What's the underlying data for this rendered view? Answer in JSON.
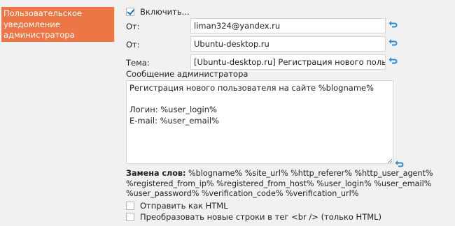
{
  "section": {
    "label_lines": [
      "Пользовательское",
      "уведомление",
      "администратора"
    ]
  },
  "enable": {
    "label": "Включить...",
    "checked": true
  },
  "fields": {
    "from_email": {
      "label": "От:",
      "value": "liman324@yandex.ru"
    },
    "from_name": {
      "label": "От:",
      "value": "Ubuntu-desktop.ru"
    },
    "subject": {
      "label": "Тема:",
      "value": "[Ubuntu-desktop.ru] Регистрация нового пользователя"
    }
  },
  "message": {
    "label": "Сообщение администратора",
    "text": "Регистрация нового пользователя на сайте %blogname%\n\nЛогин: %user_login%\nE-mail: %user_email%"
  },
  "replacements": {
    "title": "Замена слов:",
    "line1": " %blogname% %site_url% %http_referer% %http_user_agent%",
    "line2": "%registered_from_ip% %registered_from_host% %user_login% %user_email%",
    "line3": "%user_password% %verification_code% %verification_url%"
  },
  "options": {
    "send_html": {
      "label": "Отправить как HTML",
      "checked": false
    },
    "convert_newlines": {
      "label": "Преобразовать новые строки в тег <br /> (только HTML)",
      "checked": false
    }
  },
  "icons": {
    "reset": "reset-arrow-icon",
    "accent": "#ec7646",
    "reset_color": "#2e8bd2"
  }
}
